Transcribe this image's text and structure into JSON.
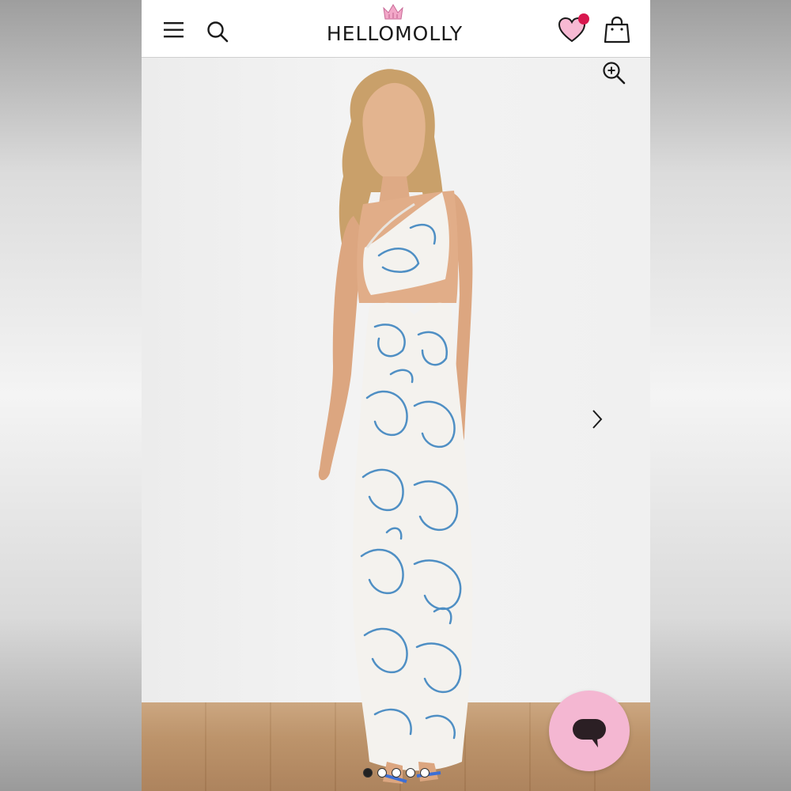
{
  "header": {
    "logo_text": "HELLOMOLLY",
    "menu_icon": "hamburger-menu-icon",
    "search_icon": "search-icon",
    "wishlist_icon": "heart-icon",
    "bag_icon": "shopping-bag-icon"
  },
  "colors": {
    "wishlist_heart": "#f7b9d3",
    "wishlist_badge": "#d8174e",
    "chat_button": "#f4b7d2",
    "header_bg": "#ffffff",
    "dress_print": "#4f8fc4"
  },
  "gallery": {
    "zoom_icon": "zoom-in-icon",
    "next_icon": "chevron-right-icon",
    "total_images": 5,
    "active_image_index": 1
  },
  "chat": {
    "icon": "chat-bubble-icon"
  }
}
